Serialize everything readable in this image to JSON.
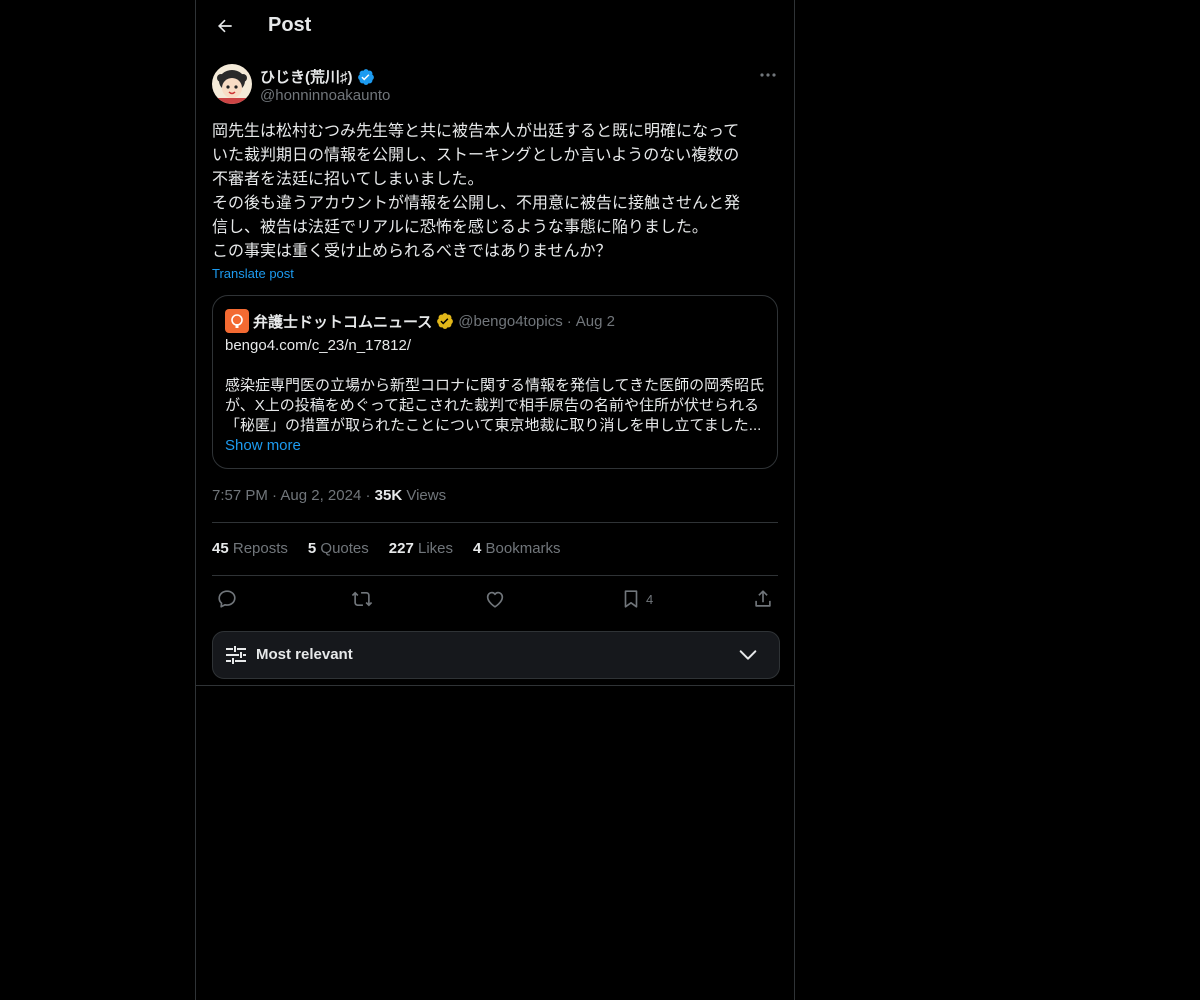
{
  "header": {
    "title": "Post"
  },
  "author": {
    "name": "ひじき(荒川♯)",
    "handle": "@honninnoakaunto"
  },
  "tweet": {
    "lines": [
      "岡先生は松村むつみ先生等と共に被告本人が出廷すると既に明確になって",
      "いた裁判期日の情報を公開し、ストーキングとしか言いようのない複数の",
      "不審者を法廷に招いてしまいました。",
      "その後も違うアカウントが情報を公開し、不用意に被告に接触させんと発",
      "信し、被告は法廷でリアルに恐怖を感じるような事態に陥りました。",
      "この事実は重く受け止められるべきではありませんか？"
    ],
    "translate": "Translate post"
  },
  "quote": {
    "name": "弁護士ドットコムニュース",
    "handle": "@bengo4topics",
    "separator": "·",
    "date": "Aug 2",
    "url": "bengo4.com/c_23/n_17812/",
    "body": [
      "感染症専門医の立場から新型コロナに関する情報を発信してきた医師の岡秀昭氏",
      "が、X上の投稿をめぐって起こされた裁判で相手原告の名前や住所が伏せられる",
      "「秘匿」の措置が取られたことについて東京地裁に取り消しを申し立てました..."
    ],
    "show_more": "Show more",
    "brand_color": "#f36a32"
  },
  "meta": {
    "time": "7:57 PM",
    "separator": "·",
    "date": "Aug 2, 2024",
    "views_count": "35K",
    "views_label": "Views"
  },
  "stats": [
    {
      "count": "45",
      "label": "Reposts"
    },
    {
      "count": "5",
      "label": "Quotes"
    },
    {
      "count": "227",
      "label": "Likes"
    },
    {
      "count": "4",
      "label": "Bookmarks"
    }
  ],
  "actions": {
    "bookmark_count": "4"
  },
  "sort": {
    "label": "Most relevant"
  },
  "colors": {
    "accent": "#1d9bf0",
    "verified": "#1d9bf0",
    "gold_verified": "#e2b719",
    "muted": "#71767b",
    "border": "#2f3336"
  }
}
